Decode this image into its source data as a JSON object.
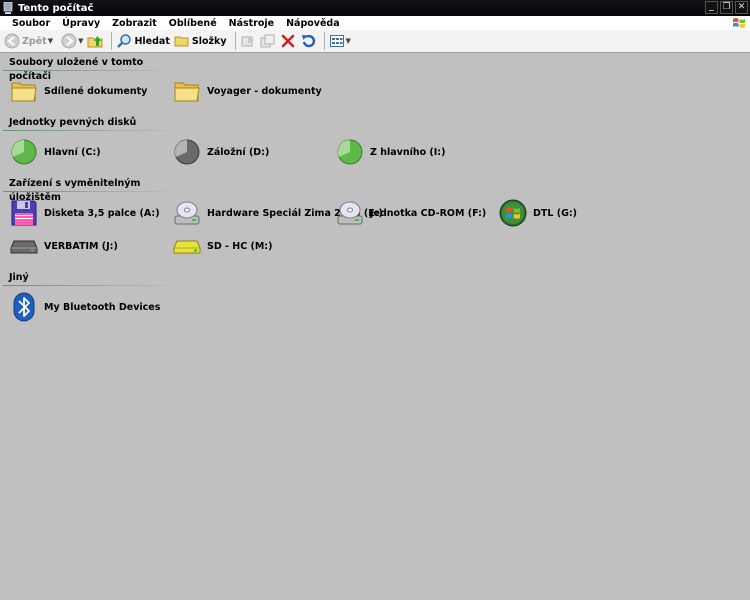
{
  "window": {
    "title": "Tento počítač"
  },
  "menu": [
    "Soubor",
    "Úpravy",
    "Zobrazit",
    "Oblíbené",
    "Nástroje",
    "Nápověda"
  ],
  "toolbar": {
    "back": "Zpět",
    "search": "Hledat",
    "folders": "Složky"
  },
  "sections": {
    "stored": {
      "title": "Soubory uložené v tomto počítači",
      "items": [
        "Sdílené dokumenty",
        "Voyager - dokumenty"
      ]
    },
    "hdd": {
      "title": "Jednotky pevných disků",
      "items": [
        "Hlavní (C:)",
        "Záložní (D:)",
        "Z hlavního (I:)"
      ]
    },
    "removable": {
      "title": "Zařízení s vyměnitelným úložištěm",
      "items": [
        "Disketa 3,5 palce (A:)",
        "Hardware Speciál Zima 2015 (E:)",
        "Jednotka CD-ROM (F:)",
        "DTL (G:)",
        "VERBATIM (J:)",
        "SD - HC (M:)"
      ]
    },
    "other": {
      "title": "Jiný",
      "items": [
        "My Bluetooth Devices"
      ]
    }
  }
}
